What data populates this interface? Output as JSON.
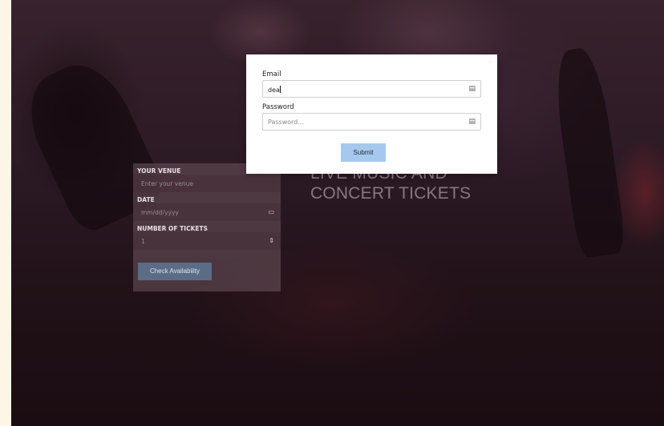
{
  "hero": {
    "line1": "LIVE MUSIC AND",
    "line2": "CONCERT TICKETS"
  },
  "booking": {
    "venue_label": "YOUR VENUE",
    "venue_placeholder": "Enter your venue",
    "date_label": "DATE",
    "date_placeholder": "mm/dd/yyyy",
    "tickets_label": "NUMBER OF TICKETS",
    "tickets_value": "1",
    "check_button": "Check Availability"
  },
  "modal": {
    "close_glyph": "·",
    "email_label": "Email",
    "email_value": "dea",
    "password_label": "Password",
    "password_placeholder": "Password...",
    "submit_label": "Submit"
  },
  "icons": {
    "field_icon": "password-manager-icon",
    "calendar": "calendar-icon",
    "stepper": "stepper-icon"
  }
}
